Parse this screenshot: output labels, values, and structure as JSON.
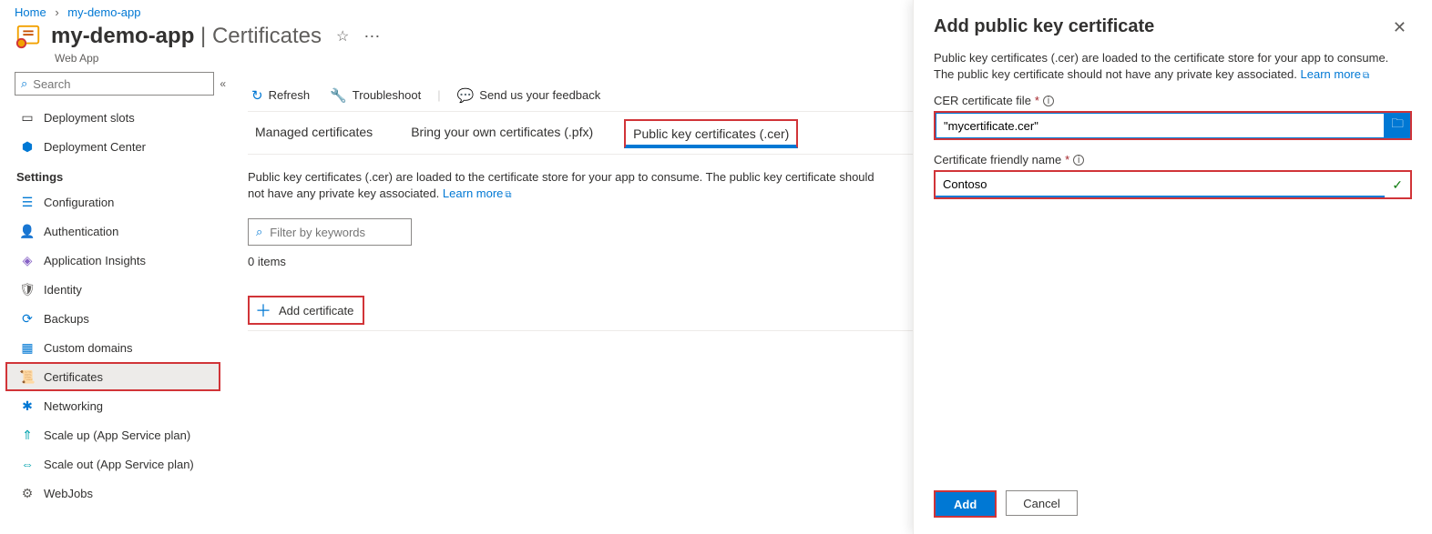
{
  "breadcrumb": {
    "home": "Home",
    "app": "my-demo-app"
  },
  "header": {
    "title_bold": "my-demo-app",
    "title_sep": " | ",
    "title_light": "Certificates",
    "subtype": "Web App"
  },
  "sidebar": {
    "search_placeholder": "Search",
    "top_items": [
      {
        "label": "Deployment slots"
      },
      {
        "label": "Deployment Center"
      }
    ],
    "settings_heading": "Settings",
    "settings_items": [
      {
        "label": "Configuration"
      },
      {
        "label": "Authentication"
      },
      {
        "label": "Application Insights"
      },
      {
        "label": "Identity"
      },
      {
        "label": "Backups"
      },
      {
        "label": "Custom domains"
      },
      {
        "label": "Certificates"
      },
      {
        "label": "Networking"
      },
      {
        "label": "Scale up (App Service plan)"
      },
      {
        "label": "Scale out (App Service plan)"
      },
      {
        "label": "WebJobs"
      }
    ]
  },
  "toolbar": {
    "refresh": "Refresh",
    "troubleshoot": "Troubleshoot",
    "feedback": "Send us your feedback"
  },
  "tabs": [
    {
      "label": "Managed certificates"
    },
    {
      "label": "Bring your own certificates (.pfx)"
    },
    {
      "label": "Public key certificates (.cer)"
    }
  ],
  "main": {
    "desc": "Public key certificates (.cer) are loaded to the certificate store for your app to consume. The public key certificate should not have any private key associated.",
    "learn_more": "Learn more",
    "filter_placeholder": "Filter by keywords",
    "count": "0 items",
    "add_cert": "Add certificate"
  },
  "flyout": {
    "title": "Add public key certificate",
    "desc": "Public key certificates (.cer) are loaded to the certificate store for your app to consume. The public key certificate should not have any private key associated.",
    "learn_more": "Learn more",
    "file_label": "CER certificate file",
    "file_value": "\"mycertificate.cer\"",
    "name_label": "Certificate friendly name",
    "name_value": "Contoso",
    "add": "Add",
    "cancel": "Cancel"
  }
}
